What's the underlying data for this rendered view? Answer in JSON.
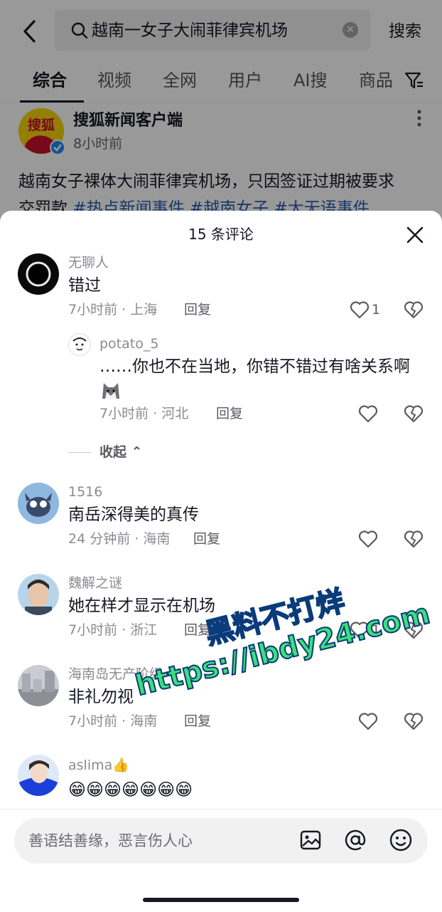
{
  "search": {
    "query": "越南一女子大闹菲律宾机场",
    "button": "搜索"
  },
  "tabs": [
    {
      "label": "综合"
    },
    {
      "label": "视频"
    },
    {
      "label": "全网"
    },
    {
      "label": "用户"
    },
    {
      "label": "AI搜"
    },
    {
      "label": "商品"
    }
  ],
  "post": {
    "author": "搜狐新闻客户端",
    "avatar_text": "搜狐",
    "time": "8小时前",
    "text": "越南女子裸体大闹菲律宾机场，只因签证过期被要求",
    "text_line2": "交罚款",
    "tags": [
      "#热点新闻事件",
      "#越南女子",
      "#大无语事件"
    ]
  },
  "sheet": {
    "title": "15 条评论",
    "collapse_label": "收起"
  },
  "comments": [
    {
      "user": "无聊人",
      "text": "错过",
      "time": "7小时前 · 上海",
      "reply_label": "回复",
      "likes": "1"
    },
    {
      "user": "potato_5",
      "text": "……你也不在当地，你错不错过有啥关系啊",
      "time": "7小时前 · 河北",
      "reply_label": "回复",
      "likes": ""
    },
    {
      "user": "1516",
      "text": "南岳深得美的真传",
      "time": "24 分钟前 · 海南",
      "reply_label": "回复",
      "likes": ""
    },
    {
      "user": "魏解之谜",
      "text": "她在样才显示在机场",
      "time": "7小时前 · 浙江",
      "reply_label": "回复",
      "likes": "1"
    },
    {
      "user": "海南岛无产阶级",
      "text": "非礼勿视",
      "time": "7小时前 · 海南",
      "reply_label": "回复",
      "likes": ""
    },
    {
      "user": "aslima👍",
      "text": "😁😁😁😁😁😁😁",
      "time": "",
      "reply_label": "",
      "likes": ""
    }
  ],
  "watermark": {
    "line1": "黑料不打烊",
    "line2": "https://ibdy24.com"
  },
  "input": {
    "placeholder": "善语结善缘，恶言伤人心"
  },
  "icons": [
    "back-icon",
    "search-icon",
    "clear-icon",
    "filter-icon",
    "more-icon",
    "close-icon",
    "heart-icon",
    "dislike-icon",
    "image-icon",
    "at-icon",
    "emoji-icon"
  ]
}
